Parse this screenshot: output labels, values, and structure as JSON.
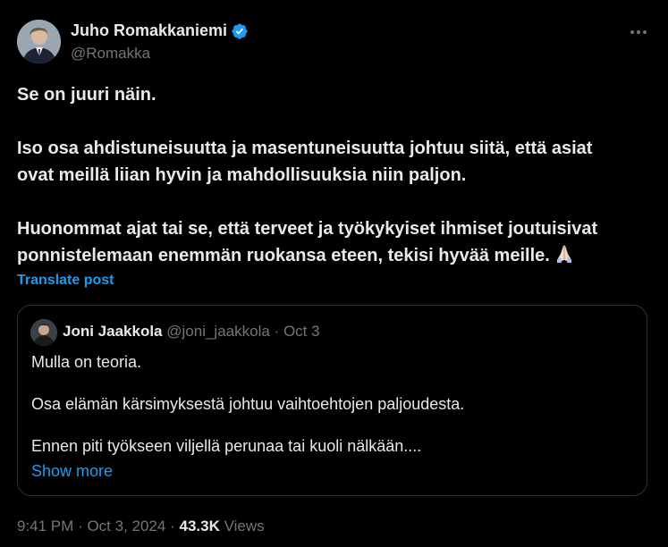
{
  "author": {
    "display_name": "Juho Romakkaniemi",
    "handle": "@Romakka",
    "verified": true
  },
  "post": {
    "lines_p1": [
      "Se on juuri näin."
    ],
    "lines_p2": [
      "Iso osa ahdistuneisuutta ja masentuneisuutta johtuu siitä, että asiat",
      "ovat meillä liian hyvin ja mahdollisuuksia niin paljon."
    ],
    "lines_p3": [
      "Huonommat ajat tai se, että terveet ja työkykyiset ihmiset joutuisivat",
      "ponnistelemaan enemmän ruokansa eteen, tekisi hyvää meille."
    ],
    "emoji": "folded-hands-emoji",
    "translate_label": "Translate post"
  },
  "quote": {
    "display_name": "Joni Jaakkola",
    "handle": "@joni_jaakkola",
    "separator": "·",
    "date": "Oct 3",
    "line1": "Mulla on teoria.",
    "line2": "Osa elämän kärsimyksestä johtuu vaihtoehtojen paljoudesta.",
    "line3": "Ennen piti työkseen viljellä perunaa tai kuoli nälkään....",
    "show_more_label": "Show more"
  },
  "meta": {
    "time": "9:41 PM",
    "separator": "·",
    "date": "Oct 3, 2024",
    "views_count": "43.3K",
    "views_label": "Views"
  },
  "colors": {
    "background": "#000000",
    "text_primary": "#e7e9ea",
    "text_secondary": "#71767b",
    "accent": "#1d9bf0",
    "border": "#2f3336"
  },
  "icons": {
    "verified": "verified-badge-icon",
    "more": "more-options-icon"
  }
}
